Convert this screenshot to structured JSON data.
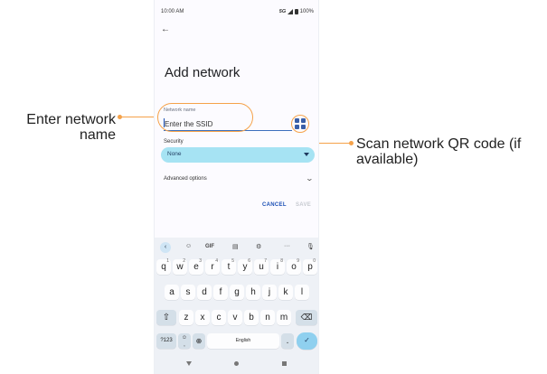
{
  "status": {
    "time": "10:00 AM",
    "network": "5G",
    "battery": "100%"
  },
  "screen": {
    "title": "Add network",
    "network_name_label": "Network name",
    "ssid_placeholder": "Enter the SSID",
    "security_label": "Security",
    "security_value": "None",
    "advanced_options": "Advanced options",
    "cancel": "CANCEL",
    "save": "SAVE"
  },
  "callouts": {
    "left": "Enter network name",
    "right": "Scan network QR code (if available)"
  },
  "keyboard": {
    "toolbar": {
      "gif": "GIF",
      "more": "···"
    },
    "row1": [
      {
        "k": "q",
        "n": "1"
      },
      {
        "k": "w",
        "n": "2"
      },
      {
        "k": "e",
        "n": "3"
      },
      {
        "k": "r",
        "n": "4"
      },
      {
        "k": "t",
        "n": "5"
      },
      {
        "k": "y",
        "n": "6"
      },
      {
        "k": "u",
        "n": "7"
      },
      {
        "k": "i",
        "n": "8"
      },
      {
        "k": "o",
        "n": "9"
      },
      {
        "k": "p",
        "n": "0"
      }
    ],
    "row2": [
      "a",
      "s",
      "d",
      "f",
      "g",
      "h",
      "j",
      "k",
      "l"
    ],
    "row3": [
      "z",
      "x",
      "c",
      "v",
      "b",
      "n",
      "m"
    ],
    "symbols": "?123",
    "emoji": "☺",
    "comma": ",",
    "space": "English",
    "period": ".",
    "shift_glyph": "⇧",
    "backspace_glyph": "⌫",
    "enter_glyph": "✓"
  },
  "colors": {
    "accent": "#1a4fb5",
    "callout": "#f5a24a",
    "dropdown": "#a6e3f3"
  }
}
